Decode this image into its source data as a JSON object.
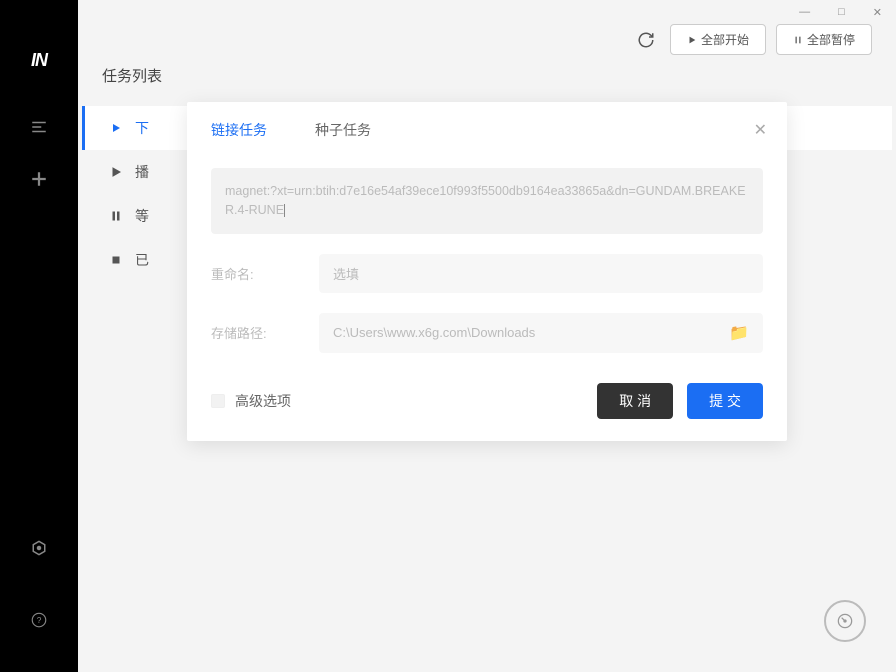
{
  "sidebar": {
    "logo": "IN"
  },
  "header": {
    "title": "任务列表",
    "refresh": "刷新",
    "startAll": "全部开始",
    "pauseAll": "全部暂停"
  },
  "tabs": {
    "items": [
      {
        "label": "下"
      },
      {
        "label": "播"
      },
      {
        "label": "等"
      },
      {
        "label": "已"
      }
    ]
  },
  "modal": {
    "tabLink": "链接任务",
    "tabSeed": "种子任务",
    "url": "magnet:?xt=urn:btih:d7e16e54af39ece10f993f5500db9164ea33865a&dn=GUNDAM.BREAKER.4-RUNE",
    "renameLabel": "重命名:",
    "renamePlaceholder": "选填",
    "pathLabel": "存储路径:",
    "pathValue": "C:\\Users\\www.x6g.com\\Downloads",
    "advanced": "高级选项",
    "cancel": "取 消",
    "submit": "提 交"
  }
}
